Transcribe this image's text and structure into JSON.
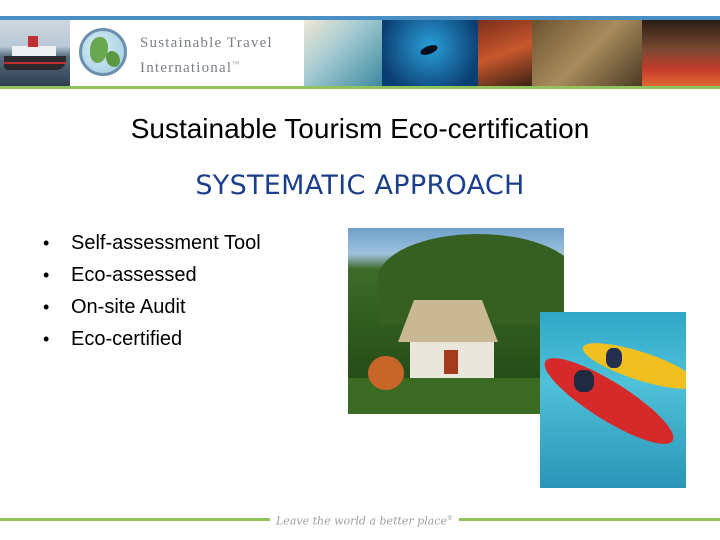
{
  "header": {
    "brand_line1": "Sustainable Travel",
    "brand_line2": "International",
    "brand_tm": "™"
  },
  "slide": {
    "title": "Sustainable Tourism Eco-certification",
    "subtitle": "SYSTEMATIC APPROACH",
    "bullets": [
      "Self-assessment Tool",
      "Eco-assessed",
      "On-site Audit",
      "Eco-certified"
    ]
  },
  "footer": {
    "tagline": "Leave the world a better place",
    "tagline_tm": "®"
  },
  "colors": {
    "subtitle": "#1c3f8c",
    "header_line_blue": "#4a8fc4",
    "accent_green": "#8fc45a",
    "brand_gray": "#7b8088"
  }
}
